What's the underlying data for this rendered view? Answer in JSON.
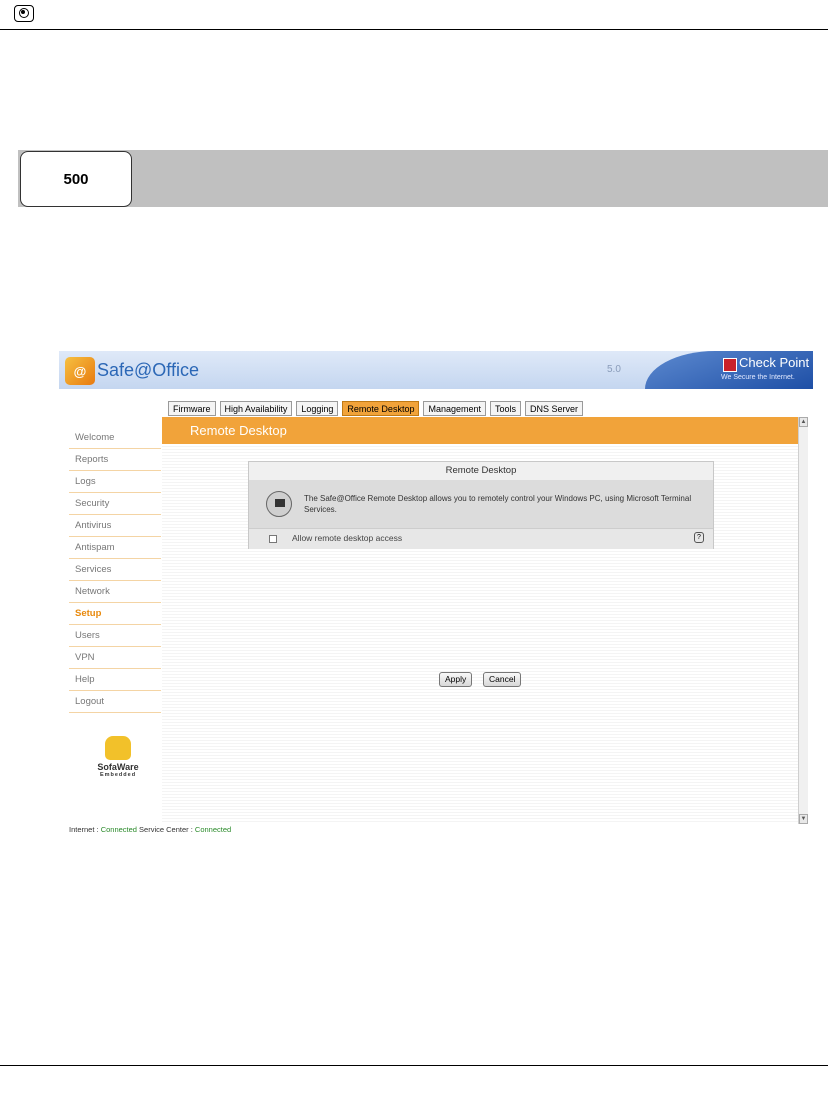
{
  "page": {
    "model_label": "500"
  },
  "app": {
    "logo_glyph": "@",
    "title": "Safe@Office",
    "version": "5.0",
    "brand": "Check Point",
    "brand_tagline": "We Secure the Internet.",
    "accent_color": "#f1a33a"
  },
  "tabs": [
    {
      "label": "Firmware"
    },
    {
      "label": "High Availability"
    },
    {
      "label": "Logging"
    },
    {
      "label": "Remote Desktop",
      "active": true
    },
    {
      "label": "Management"
    },
    {
      "label": "Tools"
    },
    {
      "label": "DNS Server"
    }
  ],
  "sidebar": {
    "items": [
      {
        "label": "Welcome"
      },
      {
        "label": "Reports"
      },
      {
        "label": "Logs"
      },
      {
        "label": "Security"
      },
      {
        "label": "Antivirus"
      },
      {
        "label": "Antispam"
      },
      {
        "label": "Services"
      },
      {
        "label": "Network"
      },
      {
        "label": "Setup",
        "active": true
      },
      {
        "label": "Users"
      },
      {
        "label": "VPN"
      },
      {
        "label": "Help"
      },
      {
        "label": "Logout"
      }
    ],
    "logo_line1": "SofaWare",
    "logo_line2": "Embedded"
  },
  "content": {
    "title": "Remote Desktop",
    "panel_title": "Remote Desktop",
    "description": "The Safe@Office Remote Desktop allows you to remotely control your Windows PC, using Microsoft Terminal Services.",
    "checkbox_label": "Allow remote desktop access",
    "checkbox_checked": false,
    "help_glyph": "?",
    "apply_label": "Apply",
    "cancel_label": "Cancel"
  },
  "status": {
    "internet_label": "Internet : ",
    "internet_value": "Connected",
    "service_label": " Service Center : ",
    "service_value": "Connected"
  }
}
